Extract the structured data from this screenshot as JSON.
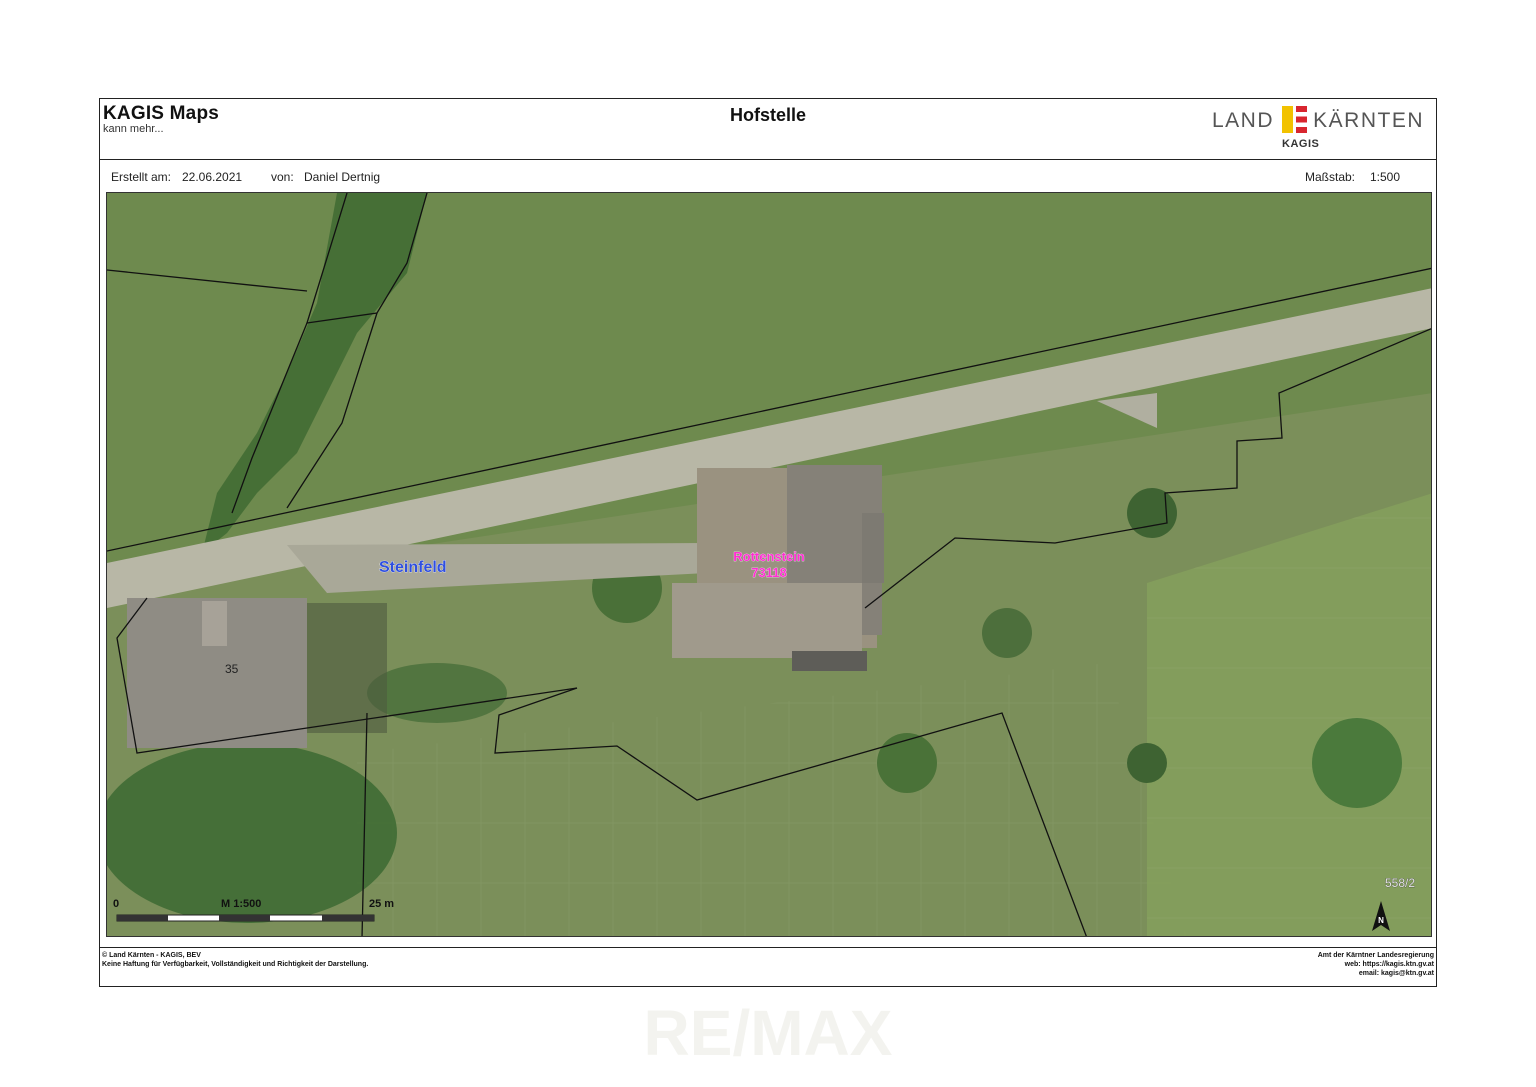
{
  "header": {
    "app_name": "KAGIS Maps",
    "tagline": "kann mehr...",
    "title": "Hofstelle",
    "logo": {
      "word_left": "LAND",
      "word_right": "KÄRNTEN",
      "sub": "KAGIS",
      "colors": {
        "yellow": "#f2c200",
        "red": "#d8262f"
      }
    }
  },
  "info": {
    "created_label": "Erstellt am:",
    "created_date": "22.06.2021",
    "author_label": "von:",
    "author": "Daniel Dertnig",
    "scale_label": "Maßstab:",
    "scale_value": "1:500"
  },
  "map": {
    "type": "aerial-orthophoto",
    "labels": {
      "street": "Steinfeld",
      "parcel_name": "Rottenstein",
      "parcel_code": "73118",
      "house_number": "35",
      "parcel_id": "558/2"
    },
    "scalebar": {
      "start": "0",
      "middle": "M 1:500",
      "end": "25 m"
    },
    "north_arrow": "N",
    "colors": {
      "street_label": "#2f4fe0",
      "parcel_label": "#ff2fd2",
      "parcel_lines": "#111111",
      "grass": "#6f8a4f",
      "road": "#b8b7a6"
    }
  },
  "footer": {
    "left_line1": "© Land Kärnten - KAGIS, BEV",
    "left_line2": "Keine Haftung für Verfügbarkeit, Vollständigkeit und Richtigkeit der Darstellung.",
    "right_line1": "Amt der Kärntner Landesregierung",
    "right_line2": "web: https://kagis.ktn.gv.at",
    "right_line3": "email: kagis@ktn.gv.at"
  },
  "watermark": "RE/MAX"
}
